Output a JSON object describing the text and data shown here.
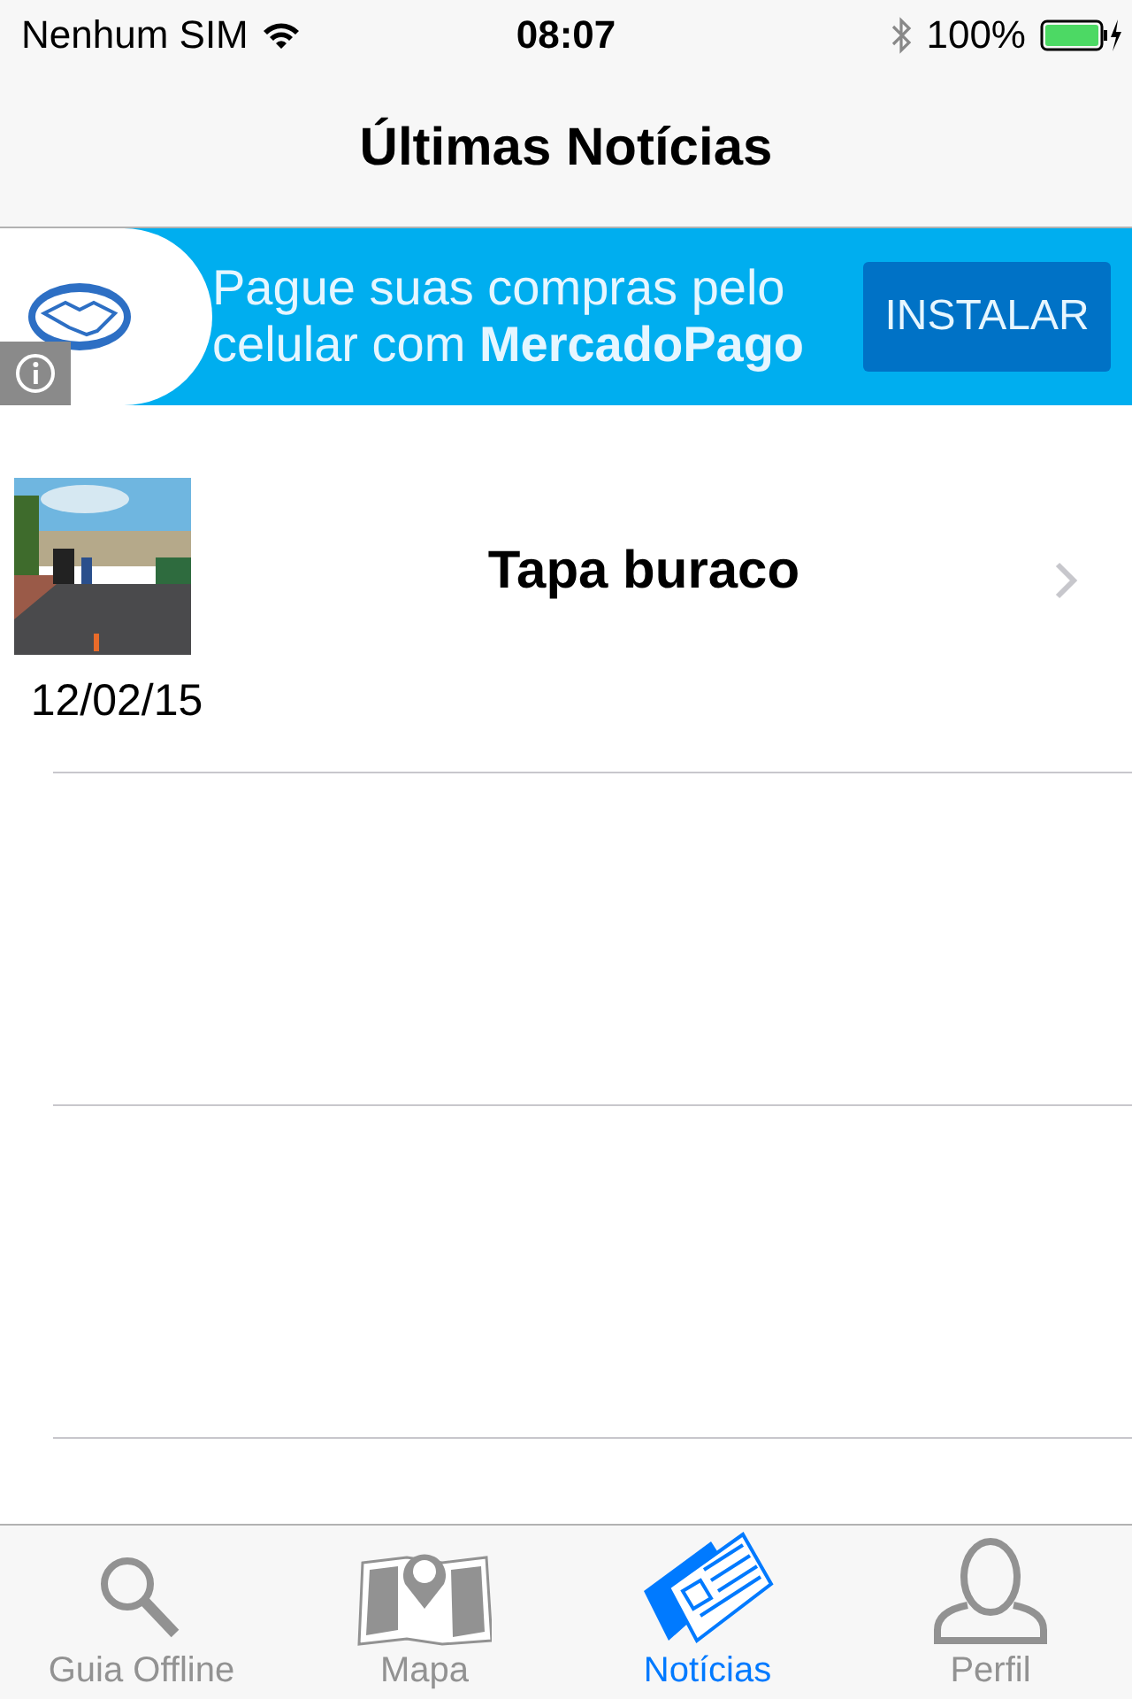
{
  "status_bar": {
    "carrier": "Nenhum SIM",
    "time": "08:07",
    "battery": "100%"
  },
  "nav": {
    "title": "Últimas Notícias"
  },
  "ad": {
    "text": "Pague suas compras pelo celular com **MercadoPago**",
    "button": "INSTALAR"
  },
  "news": [
    {
      "title": "Tapa buraco",
      "date": "12/02/15"
    }
  ],
  "tabs": [
    {
      "label": "Guia Offline",
      "selected": false
    },
    {
      "label": "Mapa",
      "selected": false
    },
    {
      "label": "Notícias",
      "selected": true
    },
    {
      "label": "Perfil",
      "selected": false
    }
  ]
}
